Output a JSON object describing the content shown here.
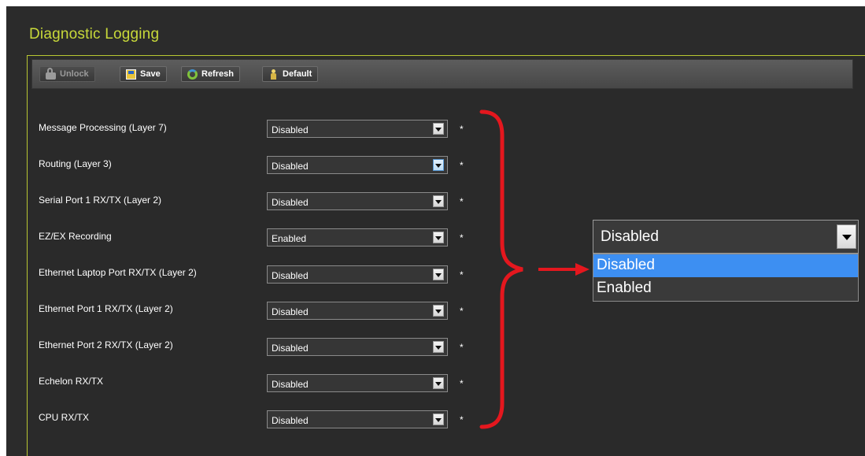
{
  "page": {
    "title": "Diagnostic Logging"
  },
  "toolbar": {
    "unlock_label": "Unlock",
    "save_label": "Save",
    "refresh_label": "Refresh",
    "default_label": "Default"
  },
  "settings": [
    {
      "label": "Message Processing (Layer 7)",
      "value": "Disabled"
    },
    {
      "label": "Routing (Layer 3)",
      "value": "Disabled"
    },
    {
      "label": "Serial Port 1 RX/TX (Layer 2)",
      "value": "Disabled"
    },
    {
      "label": "EZ/EX Recording",
      "value": "Enabled"
    },
    {
      "label": "Ethernet Laptop Port RX/TX (Layer 2)",
      "value": "Disabled"
    },
    {
      "label": "Ethernet Port 1 RX/TX (Layer 2)",
      "value": "Disabled"
    },
    {
      "label": "Ethernet Port 2 RX/TX (Layer 2)",
      "value": "Disabled"
    },
    {
      "label": "Echelon RX/TX",
      "value": "Disabled"
    },
    {
      "label": "CPU RX/TX",
      "value": "Disabled"
    }
  ],
  "required_marker": "*",
  "callout": {
    "selected_value": "Disabled",
    "options": [
      "Disabled",
      "Enabled"
    ],
    "highlighted_option": "Disabled"
  },
  "colors": {
    "title": "#c8d93a",
    "panel_border": "#b9c732",
    "annotation": "#e4171e",
    "highlight": "#3d8ff2"
  },
  "icons": [
    "lock-icon",
    "save-icon",
    "refresh-icon",
    "default-icon",
    "dropdown-arrow-icon"
  ]
}
